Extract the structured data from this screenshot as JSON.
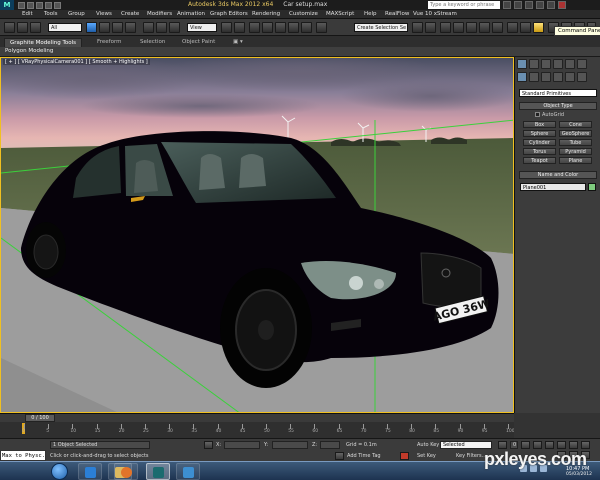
{
  "window": {
    "app_title": "Autodesk 3ds Max  2012 x64",
    "file_title": "Car setup.max",
    "search_placeholder": "Type a keyword or phrase"
  },
  "menu": [
    "Edit",
    "Tools",
    "Group",
    "Views",
    "Create",
    "Modifiers",
    "Animation",
    "Graph Editors",
    "Rendering",
    "Customize",
    "MAXScript",
    "Help",
    "RealFlow",
    "Vue 10 xStream"
  ],
  "toolbar": {
    "selection_filter": "All",
    "ref_coord": "View",
    "named_selection": "Create Selection Se"
  },
  "ribbon": {
    "tabs": [
      "Graphite Modeling Tools",
      "Freeform",
      "Selection",
      "Object Paint"
    ],
    "sub_label": "Polygon Modeling"
  },
  "viewport": {
    "label": "[ + ] [ VRayPhysicalCamera001 ] [ Smooth + Highlights ]",
    "plate_text": "AGO 36W"
  },
  "command_panel": {
    "tooltip": "Command Panel",
    "category": "Standard Primitives",
    "object_type_title": "Object Type",
    "autogrid_label": "AutoGrid",
    "objects": [
      "Box",
      "Cone",
      "Sphere",
      "GeoSphere",
      "Cylinder",
      "Tube",
      "Torus",
      "Pyramid",
      "Teapot",
      "Plane"
    ],
    "name_color_title": "Name and Color",
    "object_name": "Plane001",
    "object_color": "#7ecb7e"
  },
  "timeline": {
    "slider_label": "0 / 100",
    "ticks": [
      "0",
      "5",
      "10",
      "15",
      "20",
      "25",
      "30",
      "35",
      "40",
      "45",
      "50",
      "55",
      "60",
      "65",
      "70",
      "75",
      "80",
      "85",
      "90",
      "95",
      "100"
    ]
  },
  "status": {
    "maxscript": "Max to Physc.",
    "selection": "1 Object Selected",
    "prompt": "Click or click-and-drag to select objects",
    "x_label": "X:",
    "y_label": "Y:",
    "z_label": "Z:",
    "grid": "Grid = 0.1m",
    "add_time_tag": "Add Time Tag",
    "auto_key": "Auto Key",
    "auto_key_mode": "Selected",
    "set_key": "Set Key",
    "key_filters": "Key Filters...",
    "frame": "0"
  },
  "taskbar": {
    "time": "10:47 PM",
    "date": "05/03/2012"
  },
  "watermark": "pxleyes.com"
}
